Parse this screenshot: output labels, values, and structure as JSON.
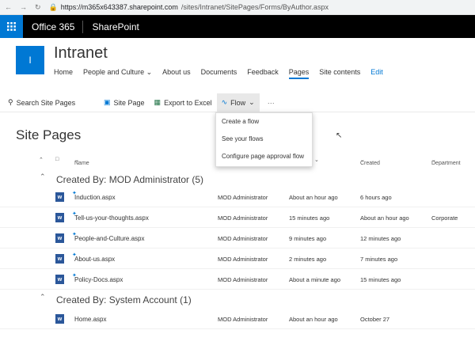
{
  "browser": {
    "url_host": "https://m365x643387.sharepoint.com",
    "url_path": "/sites/Intranet/SitePages/Forms/ByAuthor.aspx"
  },
  "suite": {
    "brand": "Office 365",
    "app": "SharePoint"
  },
  "site": {
    "logo_letter": "I",
    "title": "Intranet"
  },
  "topnav": [
    {
      "label": "Home"
    },
    {
      "label": "People and Culture"
    },
    {
      "label": "About us"
    },
    {
      "label": "Documents"
    },
    {
      "label": "Feedback"
    },
    {
      "label": "Pages"
    },
    {
      "label": "Site contents"
    },
    {
      "label": "Edit"
    }
  ],
  "commandbar": {
    "search_placeholder": "Search Site Pages",
    "site_page": "Site Page",
    "export": "Export to Excel",
    "flow": "Flow",
    "more": "···"
  },
  "flow_menu": [
    "Create a flow",
    "See your flows",
    "Configure page approval flow"
  ],
  "page_title": "Site Pages",
  "columns": {
    "name": "Name",
    "created": "Created",
    "department": "Department"
  },
  "groups": [
    {
      "title": "Created By: MOD Administrator (5)",
      "rows": [
        {
          "name": "Induction.aspx",
          "modified_by": "MOD Administrator",
          "modified": "About an hour ago",
          "created": "6 hours ago",
          "department": ""
        },
        {
          "name": "Tell-us-your-thoughts.aspx",
          "modified_by": "MOD Administrator",
          "modified": "15 minutes ago",
          "created": "About an hour ago",
          "department": "Corporate"
        },
        {
          "name": "People-and-Culture.aspx",
          "modified_by": "MOD Administrator",
          "modified": "9 minutes ago",
          "created": "12 minutes ago",
          "department": ""
        },
        {
          "name": "About-us.aspx",
          "modified_by": "MOD Administrator",
          "modified": "2 minutes ago",
          "created": "7 minutes ago",
          "department": ""
        },
        {
          "name": "Policy-Docs.aspx",
          "modified_by": "MOD Administrator",
          "modified": "About a minute ago",
          "created": "15 minutes ago",
          "department": ""
        }
      ]
    },
    {
      "title": "Created By: System Account (1)",
      "rows": [
        {
          "name": "Home.aspx",
          "modified_by": "MOD Administrator",
          "modified": "About an hour ago",
          "created": "October 27",
          "department": ""
        }
      ]
    }
  ],
  "colors": {
    "accent": "#0078d4",
    "suite_bg": "#000000",
    "word_icon": "#2b579a"
  }
}
